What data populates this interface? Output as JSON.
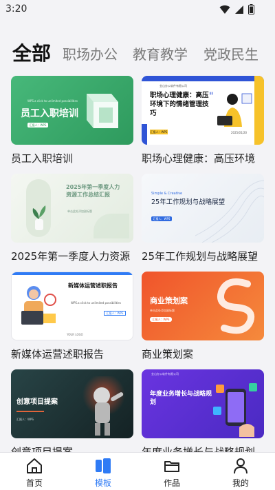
{
  "status_bar": {
    "time": "3:20",
    "icons": [
      "wifi-icon",
      "signal-icon",
      "battery-icon"
    ]
  },
  "category_tabs": [
    {
      "label": "全部",
      "active": true
    },
    {
      "label": "职场办公",
      "active": false
    },
    {
      "label": "教育教学",
      "active": false
    },
    {
      "label": "党政民生",
      "active": false
    }
  ],
  "templates": [
    {
      "title": "员工入职培训",
      "thumb_title": "员工入职培训",
      "thumb_sub": "WPS.a click to unlimited possibilities",
      "thumb_btn": "汇报人：WPS",
      "bg": "#3aa86b"
    },
    {
      "title": "职场心理健康：高压环境",
      "thumb_title": "职场心理健康：高压环境下的情绪管理技巧",
      "thumb_btn": "汇报人：WPS",
      "thumb_company": "金山办公软件有限公司",
      "thumb_date": "2025/01/20",
      "bg": "#ffffff"
    },
    {
      "title": "2025年第一季度人力资源",
      "thumb_title": "2025年第一季度人力资源工作总结汇报",
      "thumb_sub": "单击此处添加副标题",
      "bg": "#eef3ec"
    },
    {
      "title": "25年工作规划与战略展望",
      "thumb_title": "25年工作规划与战略展望",
      "thumb_tag": "Simple & Creative",
      "thumb_btn": "汇报人：WPS",
      "bg": "#f4f7fb"
    },
    {
      "title": "新媒体运营述职报告",
      "thumb_title": "新媒体运营述职报告",
      "thumb_sub": "WPS.a click to unlimited possibilities",
      "thumb_btn": "汇报人：WPS",
      "thumb_logo": "YOUR LOGO",
      "bg": "#ffffff"
    },
    {
      "title": "商业策划案",
      "thumb_title": "商业策划案",
      "thumb_sub": "单击此处添加副标题",
      "thumb_btn": "汇报人：WPS",
      "bg": "#f25a2b"
    },
    {
      "title": "创意项目提案",
      "thumb_title": "创意项目提案",
      "thumb_btn": "汇报人：WPS",
      "bg": "#1e3838"
    },
    {
      "title": "年度业务增长与战略规划",
      "thumb_title": "年度业务增长与战略规划",
      "thumb_company": "金山办公软件有限公司",
      "bg": "#5a2fd6"
    }
  ],
  "bottom_nav": [
    {
      "label": "首页",
      "icon": "home-icon",
      "active": false
    },
    {
      "label": "模板",
      "icon": "template-icon",
      "active": true
    },
    {
      "label": "作品",
      "icon": "folder-icon",
      "active": false
    },
    {
      "label": "我的",
      "icon": "user-icon",
      "active": false
    }
  ],
  "colors": {
    "accent": "#2f7bf5",
    "background": "#f3f3f6"
  }
}
